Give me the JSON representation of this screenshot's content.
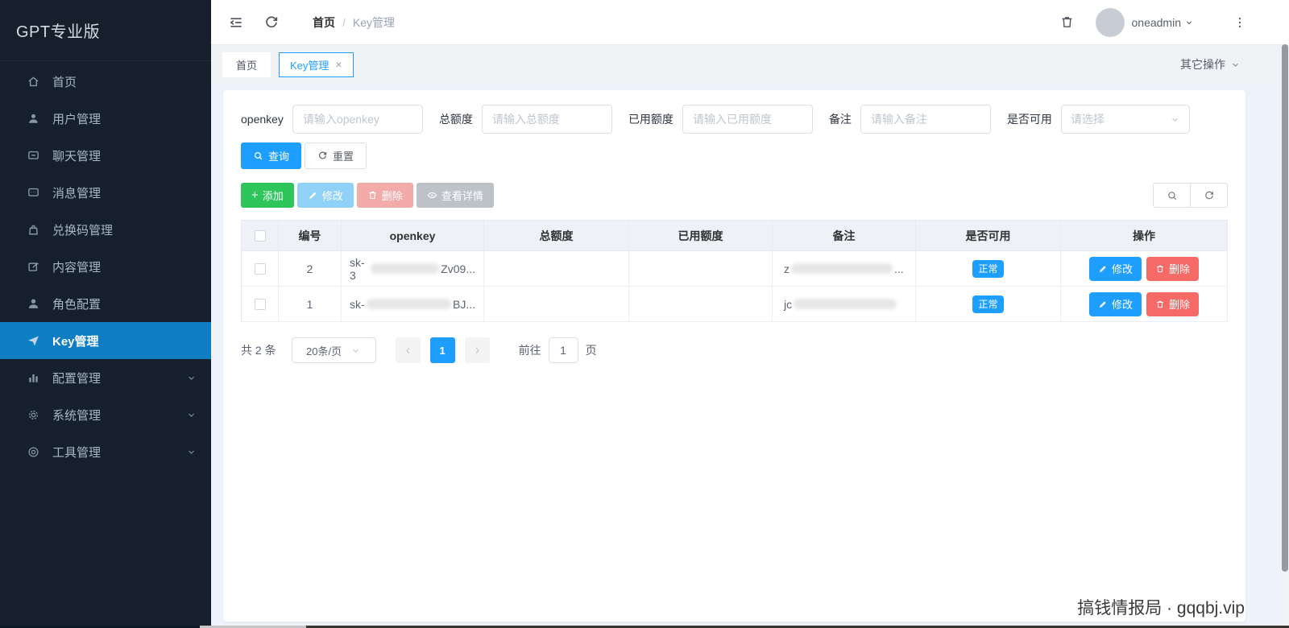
{
  "app": {
    "title": "GPT专业版"
  },
  "sidebar": {
    "items": [
      {
        "label": "首页",
        "icon": "home"
      },
      {
        "label": "用户管理",
        "icon": "user"
      },
      {
        "label": "聊天管理",
        "icon": "chat"
      },
      {
        "label": "消息管理",
        "icon": "message"
      },
      {
        "label": "兑换码管理",
        "icon": "bag"
      },
      {
        "label": "内容管理",
        "icon": "edit-square"
      },
      {
        "label": "角色配置",
        "icon": "person"
      },
      {
        "label": "Key管理",
        "icon": "paper-plane",
        "active": true
      },
      {
        "label": "配置管理",
        "icon": "bar-chart",
        "expandable": true
      },
      {
        "label": "系统管理",
        "icon": "gear",
        "expandable": true
      },
      {
        "label": "工具管理",
        "icon": "tools",
        "expandable": true
      }
    ]
  },
  "topbar": {
    "breadcrumb": {
      "root": "首页",
      "separator": "/",
      "current": "Key管理"
    },
    "username": "oneadmin"
  },
  "tabs": {
    "items": [
      {
        "label": "首页"
      },
      {
        "label": "Key管理",
        "active": true,
        "closable": true
      }
    ],
    "close_glyph": "×",
    "more_actions": "其它操作"
  },
  "filters": {
    "fields": [
      {
        "label": "openkey",
        "placeholder": "请输入openkey",
        "type": "input"
      },
      {
        "label": "总额度",
        "placeholder": "请输入总额度",
        "type": "input"
      },
      {
        "label": "已用额度",
        "placeholder": "请输入已用额度",
        "type": "input"
      },
      {
        "label": "备注",
        "placeholder": "请输入备注",
        "type": "input"
      },
      {
        "label": "是否可用",
        "placeholder": "请选择",
        "type": "select"
      }
    ],
    "search_label": "查询",
    "reset_label": "重置"
  },
  "toolbar": {
    "add": "添加",
    "edit": "修改",
    "delete": "删除",
    "detail": "查看详情",
    "add_plus": "+"
  },
  "table": {
    "columns": [
      "编号",
      "openkey",
      "总额度",
      "已用额度",
      "备注",
      "是否可用",
      "操作"
    ],
    "rows": [
      {
        "id": "2",
        "key_prefix": "sk-3",
        "key_suffix": "Zv09...",
        "total_quota": "",
        "used_quota": "",
        "remark_prefix": "z",
        "remark_suffix": "...",
        "status": "正常"
      },
      {
        "id": "1",
        "key_prefix": "sk-",
        "key_suffix": "BJ...",
        "total_quota": "",
        "used_quota": "",
        "remark_prefix": "jc",
        "remark_suffix": "",
        "status": "正常"
      }
    ],
    "actions": {
      "edit": "修改",
      "delete": "删除"
    }
  },
  "pagination": {
    "total": "共 2 条",
    "page_size": "20条/页",
    "current_page": "1",
    "goto_label": "前往",
    "goto_value": "1",
    "unit_label": "页"
  },
  "watermark": "搞钱情报局 · gqqbj.vip",
  "colors": {
    "accent_blue": "#1e9fff",
    "success_green": "#2ec55b",
    "danger_red": "#f56a66",
    "sidebar_bg": "#16202c",
    "sidebar_active": "#0e7ec4",
    "table_header_bg": "#eef1f6",
    "tabstrip_bg": "#f0f2f5"
  }
}
